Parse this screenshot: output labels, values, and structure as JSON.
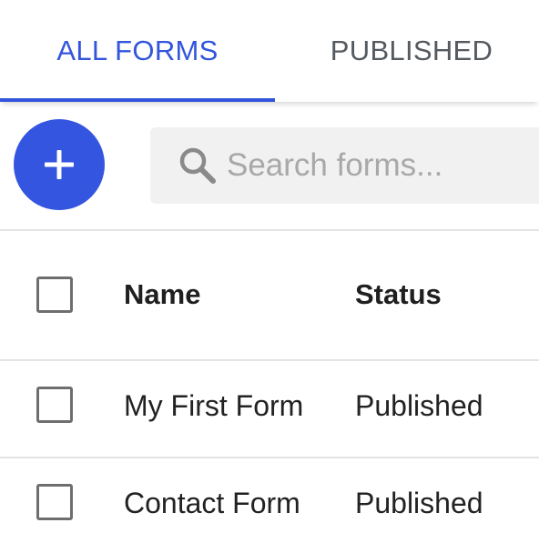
{
  "tabs": [
    {
      "label": "ALL FORMS",
      "active": true
    },
    {
      "label": "PUBLISHED",
      "active": false
    }
  ],
  "colors": {
    "accent": "#3355dd",
    "fab": "#3355e0",
    "inactive_tab": "#555a60"
  },
  "toolbar": {
    "add_button_icon": "plus-icon",
    "search": {
      "icon": "search-icon",
      "placeholder": "Search forms...",
      "value": ""
    }
  },
  "table": {
    "headers": {
      "name": "Name",
      "status": "Status"
    },
    "rows": [
      {
        "name": "My First Form",
        "status": "Published",
        "checked": false
      },
      {
        "name": "Contact Form",
        "status": "Published",
        "checked": false
      }
    ]
  }
}
